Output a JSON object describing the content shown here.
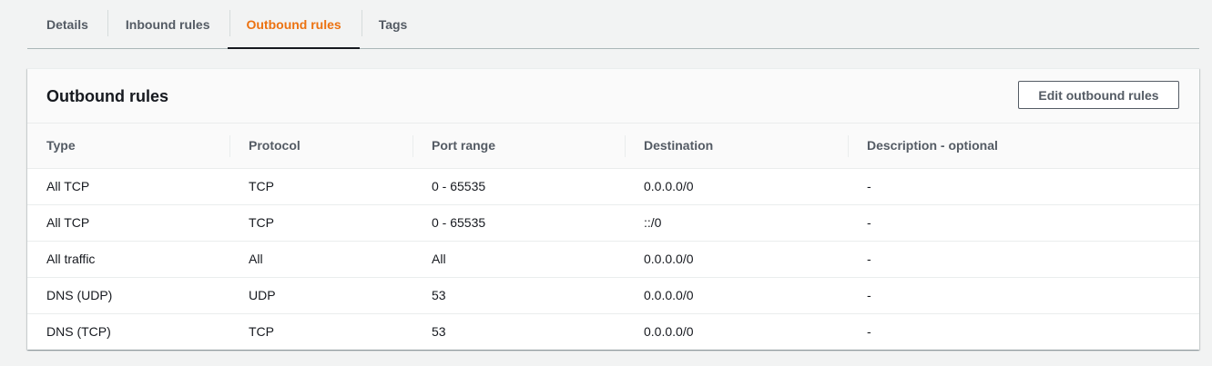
{
  "tabs": [
    {
      "label": "Details",
      "active": false
    },
    {
      "label": "Inbound rules",
      "active": false
    },
    {
      "label": "Outbound rules",
      "active": true
    },
    {
      "label": "Tags",
      "active": false
    }
  ],
  "panel": {
    "title": "Outbound rules",
    "edit_button_label": "Edit outbound rules"
  },
  "table": {
    "columns": [
      "Type",
      "Protocol",
      "Port range",
      "Destination",
      "Description - optional"
    ],
    "rows": [
      [
        "All TCP",
        "TCP",
        "0 - 65535",
        "0.0.0.0/0",
        "-"
      ],
      [
        "All TCP",
        "TCP",
        "0 - 65535",
        "::/0",
        "-"
      ],
      [
        "All traffic",
        "All",
        "All",
        "0.0.0.0/0",
        "-"
      ],
      [
        "DNS (UDP)",
        "UDP",
        "53",
        "0.0.0.0/0",
        "-"
      ],
      [
        "DNS (TCP)",
        "TCP",
        "53",
        "0.0.0.0/0",
        "-"
      ]
    ]
  },
  "colors": {
    "active_tab": "#ec7211",
    "tab_text": "#545b64",
    "background": "#f2f3f3"
  }
}
